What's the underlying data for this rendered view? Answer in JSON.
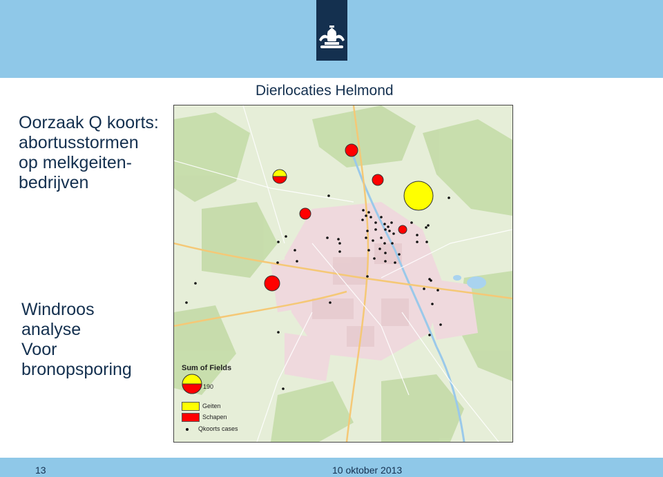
{
  "slide": {
    "title_lines": [
      "Oorzaak Q koorts:",
      "abortusstormen",
      "op melkgeiten-",
      "bedrijven"
    ],
    "subtitle_lines": [
      "Windroos",
      "analyse",
      "Voor",
      "bronopsporing"
    ],
    "page_number": "13",
    "date": "10 oktober 2013"
  },
  "branding": {
    "logo": "rijksoverheid-crest-icon",
    "color": "#14304f"
  },
  "colors": {
    "band": "#8fc8e8",
    "geiten": "#ffff00",
    "schapen": "#ff0000",
    "cases": "#111111"
  },
  "map": {
    "title": "Dierlocaties Helmond",
    "legend": {
      "title": "Sum of Fields",
      "size_value": "190",
      "items": [
        {
          "label": "Geiten",
          "symbol": "yellow-swatch"
        },
        {
          "label": "Schapen",
          "symbol": "red-swatch"
        },
        {
          "label": "Qkoorts cases",
          "symbol": "dot"
        }
      ]
    }
  }
}
